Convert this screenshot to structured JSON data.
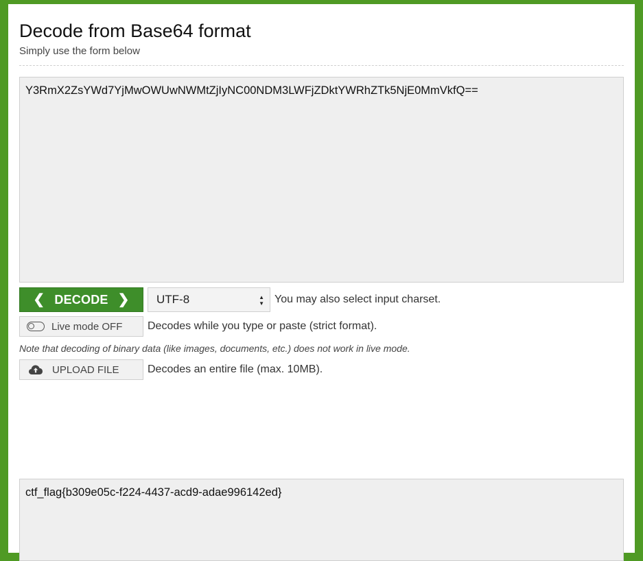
{
  "header": {
    "title": "Decode from Base64 format",
    "subtitle": "Simply use the form below"
  },
  "input": {
    "value": "Y3RmX2ZsYWd7YjMwOWUwNWMtZjIyNC00NDM3LWFjZDktYWRhZTk5NjE0MmVkfQ=="
  },
  "decode_button": {
    "label": "DECODE",
    "left_icon": "chevron-left-icon",
    "right_icon": "chevron-right-icon"
  },
  "charset": {
    "selected": "UTF-8",
    "hint": "You may also select input charset."
  },
  "live_mode": {
    "label": "Live mode OFF",
    "enabled": false,
    "description": "Decodes while you type or paste (strict format)."
  },
  "note": "Note that decoding of binary data (like images, documents, etc.) does not work in live mode.",
  "upload": {
    "label": "UPLOAD FILE",
    "icon": "cloud-upload-icon",
    "description": "Decodes an entire file (max. 10MB)."
  },
  "output": {
    "value": "ctf_flag{b309e05c-f224-4437-acd9-adae996142ed}"
  },
  "colors": {
    "background_green": "#4f9a24",
    "button_green": "#3e8e2a",
    "field_gray": "#efefef"
  }
}
